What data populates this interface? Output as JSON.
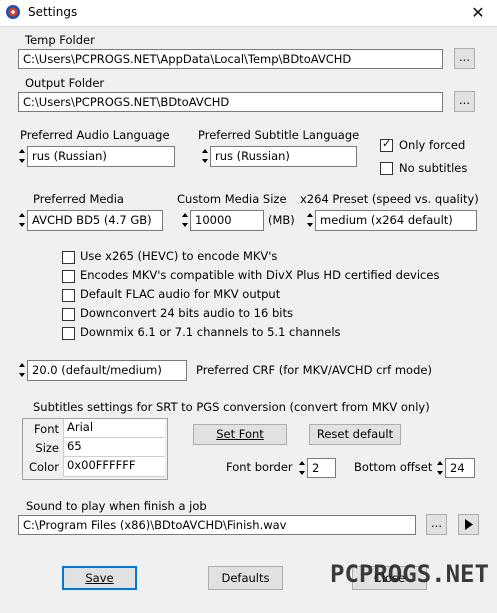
{
  "window": {
    "title": "Settings",
    "close_glyph": "✕"
  },
  "temp_folder": {
    "label": "Temp Folder",
    "value": "C:\\Users\\PCPROGS.NET\\AppData\\Local\\Temp\\BDtoAVCHD",
    "browse": "..."
  },
  "output_folder": {
    "label": "Output Folder",
    "value": "C:\\Users\\PCPROGS.NET\\BDtoAVCHD",
    "browse": "..."
  },
  "audio_language": {
    "label": "Preferred Audio Language",
    "value": "rus (Russian)"
  },
  "subtitle_language": {
    "label": "Preferred Subtitle Language",
    "value": "rus (Russian)"
  },
  "only_forced": {
    "label": "Only forced",
    "checked": true
  },
  "no_subtitles": {
    "label": "No subtitles",
    "checked": false
  },
  "preferred_media": {
    "label": "Preferred Media",
    "value": "AVCHD BD5 (4.7 GB)"
  },
  "custom_media_size": {
    "label": "Custom Media Size",
    "value": "10000",
    "unit": "(MB)"
  },
  "x264_preset": {
    "label": "x264 Preset (speed vs. quality)",
    "value": "medium (x264 default)"
  },
  "options": [
    {
      "label": "Use x265 (HEVC) to encode MKV's",
      "checked": false
    },
    {
      "label": "Encodes MKV's compatible with DivX Plus HD certified devices",
      "checked": false
    },
    {
      "label": "Default FLAC audio for MKV output",
      "checked": false
    },
    {
      "label": "Downconvert 24 bits audio to 16 bits",
      "checked": false
    },
    {
      "label": "Downmix 6.1 or 7.1 channels to 5.1 channels",
      "checked": false
    }
  ],
  "crf": {
    "value": "20.0 (default/medium)",
    "label": "Preferred CRF (for MKV/AVCHD crf mode)"
  },
  "subtitles": {
    "heading": "Subtitles settings for SRT to PGS conversion (convert from MKV only)",
    "rows": [
      {
        "label": "Font",
        "value": "Arial"
      },
      {
        "label": "Size",
        "value": "65"
      },
      {
        "label": "Color",
        "value": "0x00FFFFFF"
      }
    ],
    "set_font": "Set Font",
    "reset_default": "Reset default",
    "font_border_label": "Font border",
    "font_border_value": "2",
    "bottom_offset_label": "Bottom offset",
    "bottom_offset_value": "24"
  },
  "sound": {
    "label": "Sound to play when finish a job",
    "value": "C:\\Program Files (x86)\\BDtoAVCHD\\Finish.wav",
    "browse": "..."
  },
  "footer": {
    "save": "Save",
    "defaults": "Defaults",
    "close": "Close"
  },
  "watermark": "PCPROGS.NET",
  "icons": {
    "app": "bdtoavchd-app-icon",
    "play": "play-icon",
    "spin": "spin-arrows-icon",
    "close": "close-icon"
  }
}
